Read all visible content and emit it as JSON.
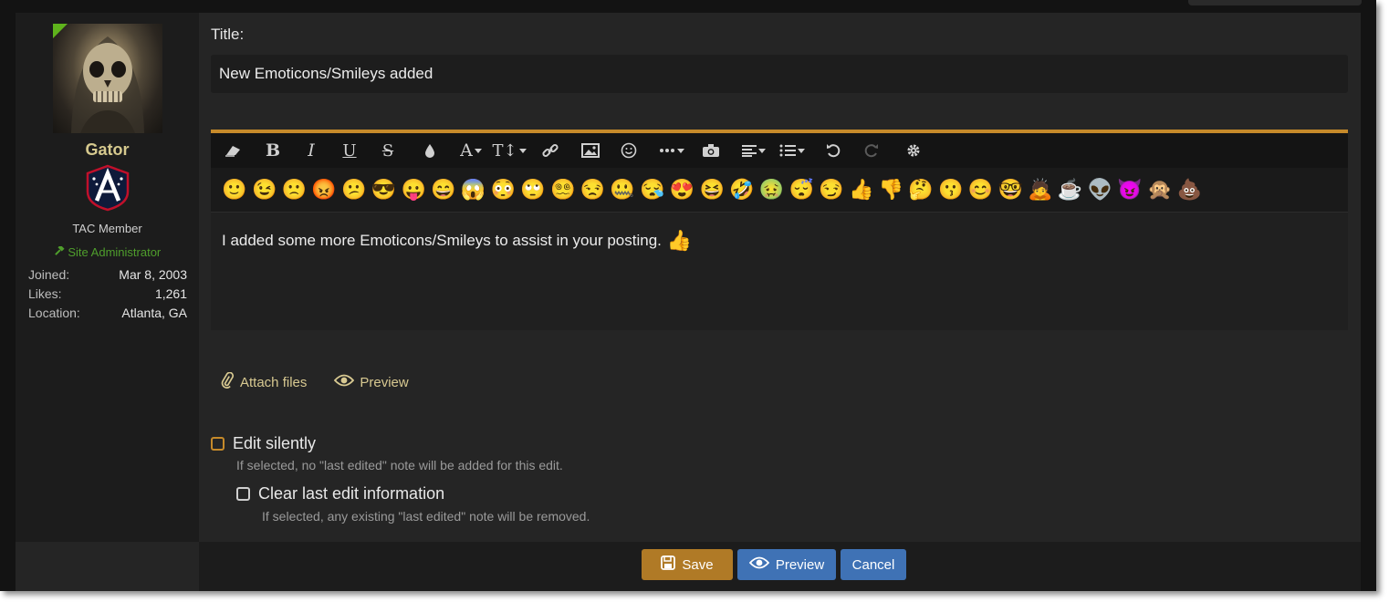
{
  "user": {
    "username": "Gator",
    "member_title": "TAC Member",
    "staff_title": "Site Administrator",
    "stats": [
      {
        "key": "Joined:",
        "value": "Mar 8, 2003"
      },
      {
        "key": "Likes:",
        "value": "1,261"
      },
      {
        "key": "Location:",
        "value": "Atlanta, GA"
      }
    ]
  },
  "form": {
    "title_label": "Title:",
    "title_value": "New Emoticons/Smileys added"
  },
  "toolbar": {
    "icons": [
      "eraser-icon",
      "bold-icon",
      "italic-icon",
      "underline-icon",
      "strikethrough-icon",
      "text-color-icon",
      "font-family-icon",
      "font-size-icon",
      "link-icon",
      "image-icon",
      "smilie-icon",
      "more-icon",
      "media-icon",
      "align-icon",
      "list-icon",
      "undo-icon",
      "redo-icon",
      "settings-icon"
    ]
  },
  "emojis": [
    "🙂",
    "😉",
    "🙁",
    "😡",
    "😕",
    "😎",
    "😛",
    "😄",
    "😱",
    "😳",
    "🙄",
    "😵‍💫",
    "😒",
    "🤐",
    "😪",
    "😍",
    "😆",
    "🤣",
    "🤢",
    "😴",
    "😏",
    "👍",
    "👎",
    "🤔",
    "😗",
    "😊",
    "🤓",
    "🙇",
    "☕",
    "👽",
    "😈",
    "🙊",
    "💩"
  ],
  "editor": {
    "body_text": "I added some more Emoticons/Smileys to assist in your posting.",
    "body_emoji": "👍"
  },
  "actions": {
    "attach_label": "Attach files",
    "preview_label": "Preview"
  },
  "options": {
    "edit_silently_label": "Edit silently",
    "edit_silently_hint": "If selected, no \"last edited\" note will be added for this edit.",
    "clear_edit_label": "Clear last edit information",
    "clear_edit_hint": "If selected, any existing \"last edited\" note will be removed."
  },
  "buttons": {
    "save": "Save",
    "preview": "Preview",
    "cancel": "Cancel"
  },
  "colors": {
    "accent": "#c68a2a",
    "username": "#d6c98e",
    "staff": "#4f9e2c",
    "save_button": "#b07a26",
    "preview_button": "#3f72b5",
    "cancel_button": "#3f72b5"
  }
}
